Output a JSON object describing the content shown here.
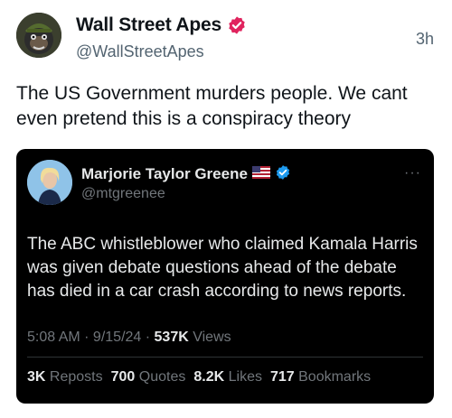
{
  "outer_post": {
    "author_name": "Wall Street Apes",
    "handle": "@WallStreetApes",
    "time": "3h",
    "text": "The US Government murders people. We cant even pretend this is a conspiracy theory",
    "avatar_icon": "gorilla-avatar",
    "verified_icon": "verified-badge-red",
    "verified_color": "#e0245e"
  },
  "quoted_post": {
    "author_name": "Marjorie Taylor Greene",
    "handle": "@mtgreenee",
    "flag_icon": "us-flag-icon",
    "verified_icon": "verified-badge-blue",
    "verified_color": "#1d9bf0",
    "more_label": "···",
    "text": "The ABC whistleblower who claimed Kamala Harris was given debate questions ahead of the debate has died in a car crash according to news reports.",
    "meta": {
      "time": "5:08 AM",
      "sep1": " · ",
      "date": "9/15/24",
      "sep2": " · ",
      "views_count": "537K",
      "views_label": " Views"
    },
    "stats": [
      {
        "count": "3K",
        "label": "Reposts"
      },
      {
        "count": "700",
        "label": "Quotes"
      },
      {
        "count": "8.2K",
        "label": "Likes"
      },
      {
        "count": "717",
        "label": "Bookmarks"
      }
    ],
    "background_color": "#000000"
  }
}
